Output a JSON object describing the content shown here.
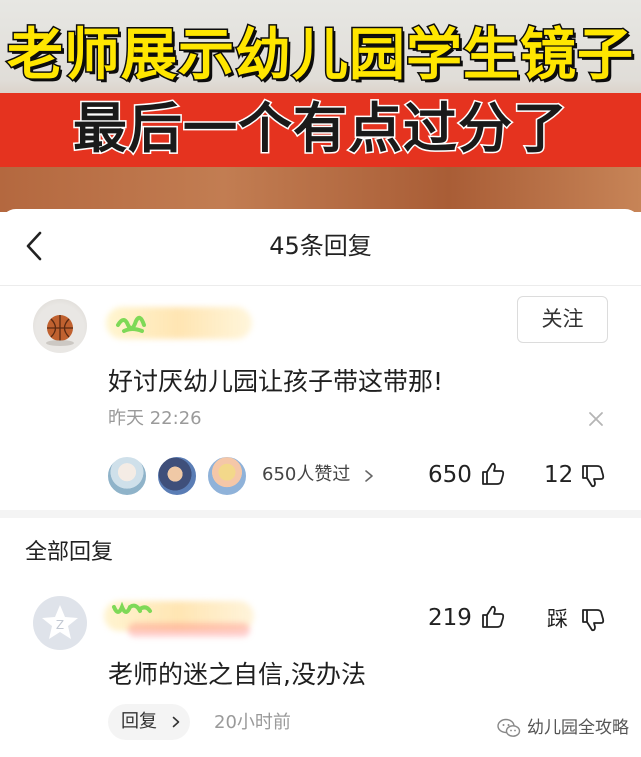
{
  "banner": {
    "title_line1": "老师展示幼儿园学生镜子",
    "title_line2": "最后一个有点过分了"
  },
  "panel": {
    "title": "45条回复"
  },
  "main_comment": {
    "follow_label": "关注",
    "text": "好讨厌幼儿园让孩子带这带那!",
    "time": "昨天  22:26",
    "likes_summary": "650人赞过",
    "like_count": "650",
    "dislike_count": "12",
    "avatar_icon": "basketball-avatar"
  },
  "replies_section": {
    "title": "全部回复"
  },
  "reply": {
    "like_count": "219",
    "dislike_label": "踩",
    "text": "老师的迷之自信,没办法",
    "reply_button_label": "回复",
    "time": "20小时前",
    "avatar_icon": "default-qq-avatar"
  },
  "watermark": {
    "text": "幼儿园全攻略",
    "icon": "wechat-icon"
  },
  "colors": {
    "banner_yellow": "#ffe600",
    "banner_red": "#e5331f",
    "text_primary": "#222222",
    "text_secondary": "#9a9a9a"
  }
}
